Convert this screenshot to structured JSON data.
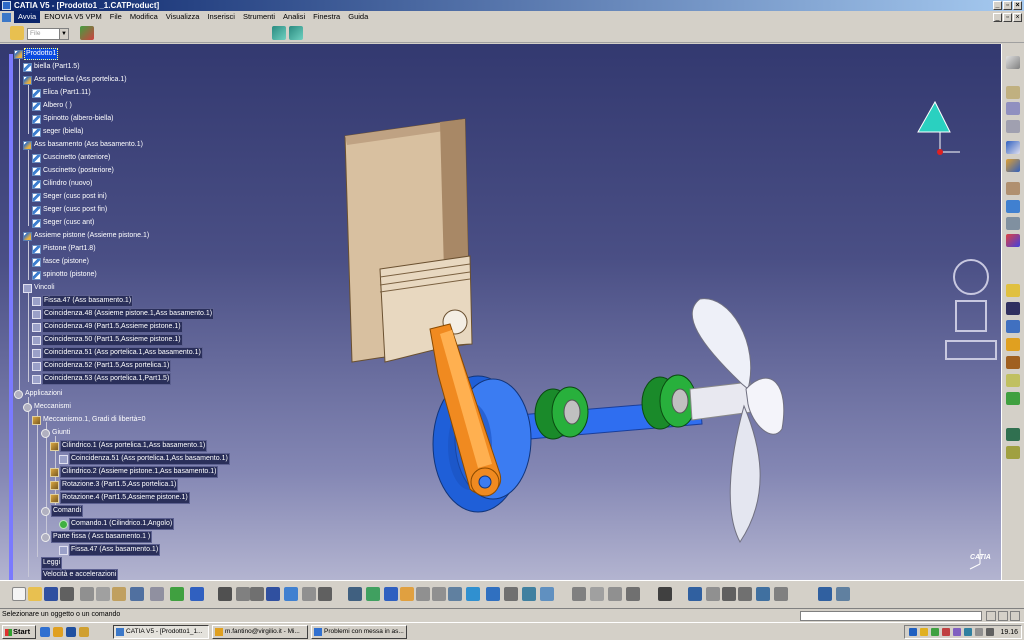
{
  "window": {
    "title": "CATIA V5 - [Prodotto1 _1.CATProduct]"
  },
  "menu": [
    "Avvia",
    "ENOVIA V5 VPM",
    "File",
    "Modifica",
    "Visualizza",
    "Inserisci",
    "Strumenti",
    "Analisi",
    "Finestra",
    "Guida"
  ],
  "toolbar": {
    "filter_combo": "File"
  },
  "tree": {
    "root": "Prodotto1",
    "items": [
      "biella (Part1.5)",
      "Ass portelica (Ass portelica.1)",
      "Elica (Part1.11)",
      "Albero ( )",
      "Spinotto (albero-biella)",
      "seger (biella)",
      "Ass basamento (Ass basamento.1)",
      "Cuscinetto (anteriore)",
      "Cuscinetto (posteriore)",
      "Cilindro (nuovo)",
      "Seger (cusc post ini)",
      "Seger (cusc post fin)",
      "Seger (cusc ant)",
      "Assieme pistone (Assieme pistone.1)",
      "Pistone (Part1.8)",
      "fasce (pistone)",
      "spinotto (pistone)",
      "Vincoli",
      "Fissa.47 (Ass basamento.1)",
      "Coincidenza.48 (Assieme pistone.1,Ass basamento.1)",
      "Coincidenza.49 (Part1.5,Assieme pistone.1)",
      "Coincidenza.50 (Part1.5,Assieme pistone.1)",
      "Coincidenza.51 (Ass portelica.1,Ass basamento.1)",
      "Coincidenza.52 (Part1.5,Ass portelica.1)",
      "Coincidenza.53 (Ass portelica.1,Part1.5)",
      "Applicazioni",
      "Meccanismi",
      "Meccanismo.1,  Gradi di libertà=0",
      "Giunti",
      "Cilindrico.1 (Ass portelica.1,Ass basamento.1)",
      "Coincidenza.51 (Ass portelica.1,Ass basamento.1)",
      "Cilindrico.2 (Assieme pistone.1,Ass basamento.1)",
      "Rotazione.3 (Part1.5,Ass portelica.1)",
      "Rotazione.4 (Part1.5,Assieme pistone.1)",
      "Comandi",
      "Comando.1 (Cilindrico.1,Angolo)",
      "Parte fissa ( Ass basamento.1 )",
      "Fissa.47 (Ass basamento.1)",
      "Leggi",
      "Velocità e accelerazioni"
    ]
  },
  "status": {
    "message": "Selezionare un oggetto o un comando"
  },
  "taskbar": {
    "start": "Start",
    "buttons": [
      "CATIA V5 - [Prodotto1_1...",
      "m.fantino@virgilio.it - Mi...",
      "Problemi con messa in as..."
    ],
    "clock": "19.16"
  },
  "brand": {
    "catia_label": "CATIA",
    "accent": "#0a246a",
    "selection": "#0a4ae0"
  }
}
